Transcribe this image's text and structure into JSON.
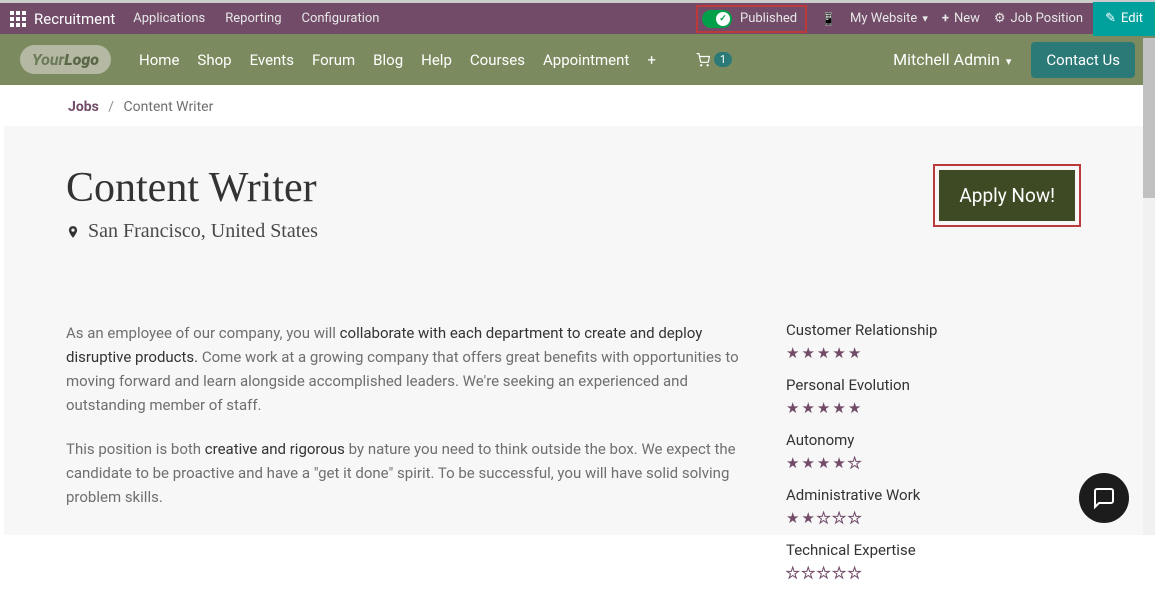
{
  "admin": {
    "app": "Recruitment",
    "nav": [
      "Applications",
      "Reporting",
      "Configuration"
    ],
    "published_label": "Published",
    "my_website": "My Website",
    "new": "New",
    "job_position": "Job Position",
    "edit": "Edit"
  },
  "site": {
    "logo_a": "Your",
    "logo_b": "Logo",
    "menu": [
      "Home",
      "Shop",
      "Events",
      "Forum",
      "Blog",
      "Help",
      "Courses",
      "Appointment"
    ],
    "cart_count": "1",
    "user": "Mitchell Admin",
    "contact": "Contact Us"
  },
  "breadcrumb": {
    "root": "Jobs",
    "current": "Content Writer"
  },
  "job": {
    "title": "Content Writer",
    "location": "San Francisco, United States",
    "apply": "Apply Now!",
    "p1_a": "As an employee of our company, you will ",
    "p1_b": "collaborate with each department to create and deploy disruptive products.",
    "p1_c": " Come work at a growing company that offers great benefits with opportunities to moving forward and learn alongside accomplished leaders. We're seeking an experienced and outstanding member of staff.",
    "p2_a": "This position is both ",
    "p2_b": "creative and rigorous",
    "p2_c": " by nature you need to think outside the box. We expect the candidate to be proactive and have a \"get it done\" spirit. To be successful, you will have solid solving problem skills."
  },
  "ratings": [
    {
      "label": "Customer Relationship",
      "stars": 5
    },
    {
      "label": "Personal Evolution",
      "stars": 5
    },
    {
      "label": "Autonomy",
      "stars": 4
    },
    {
      "label": "Administrative Work",
      "stars": 2
    },
    {
      "label": "Technical Expertise",
      "stars": 0
    }
  ]
}
